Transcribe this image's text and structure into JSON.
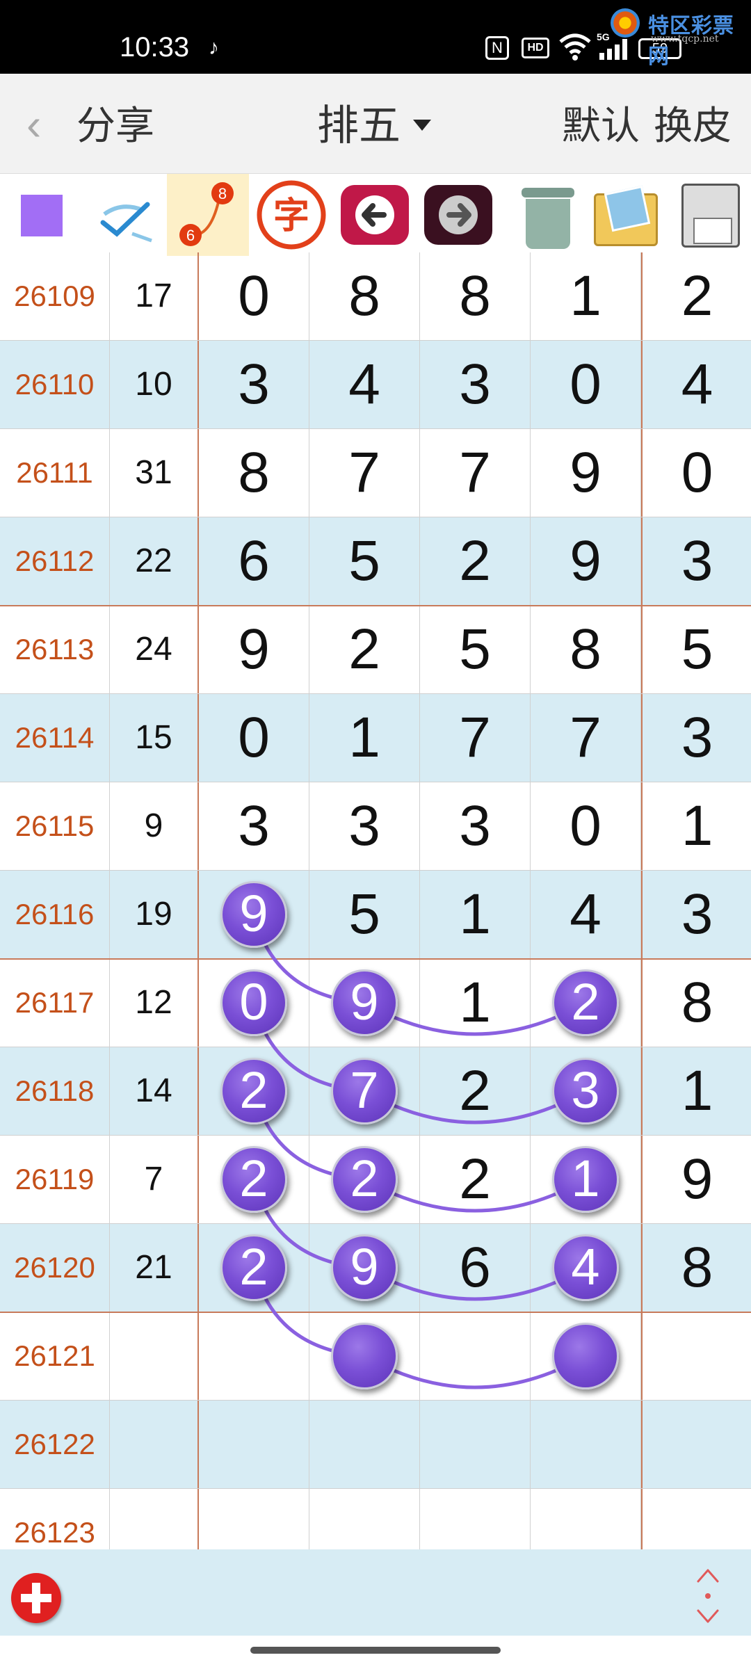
{
  "status_bar": {
    "time": "10:33",
    "hd_label": "HD",
    "battery": "59",
    "watermark_title": "特区彩票网",
    "watermark_url": "www.tqcp.net",
    "icons": [
      "tiktok-icon",
      "nfc-icon",
      "hd-icon",
      "wifi-icon",
      "5g-signal-icon",
      "battery-icon"
    ]
  },
  "header": {
    "back_icon": "chevron-left-icon",
    "share_label": "分享",
    "lottery_name": "排五",
    "default_label": "默认",
    "skin_label": "换皮"
  },
  "toolbar": {
    "tools": [
      "purple-color-swatch",
      "pen-check-tool-icon",
      "connect-line-tool-icon",
      "text-tool-icon",
      "undo-arrow-icon",
      "redo-arrow-icon",
      "trash-icon",
      "pictures-folder-icon",
      "save-floppy-icon"
    ],
    "connect_tool_labels": [
      "8",
      "6"
    ],
    "text_tool_label": "字",
    "accent_color": "#a26ef5"
  },
  "table": {
    "rows": [
      {
        "issue": "26109",
        "sum": "17",
        "digits": [
          "0",
          "8",
          "8",
          "1",
          "2"
        ]
      },
      {
        "issue": "26110",
        "sum": "10",
        "digits": [
          "3",
          "4",
          "3",
          "0",
          "4"
        ]
      },
      {
        "issue": "26111",
        "sum": "31",
        "digits": [
          "8",
          "7",
          "7",
          "9",
          "0"
        ]
      },
      {
        "issue": "26112",
        "sum": "22",
        "digits": [
          "6",
          "5",
          "2",
          "9",
          "3"
        ]
      },
      {
        "issue": "26113",
        "sum": "24",
        "digits": [
          "9",
          "2",
          "5",
          "8",
          "5"
        ]
      },
      {
        "issue": "26114",
        "sum": "15",
        "digits": [
          "0",
          "1",
          "7",
          "7",
          "3"
        ]
      },
      {
        "issue": "26115",
        "sum": "9",
        "digits": [
          "3",
          "3",
          "3",
          "0",
          "1"
        ]
      },
      {
        "issue": "26116",
        "sum": "19",
        "digits": [
          "9",
          "5",
          "1",
          "4",
          "3"
        ]
      },
      {
        "issue": "26117",
        "sum": "12",
        "digits": [
          "0",
          "9",
          "1",
          "2",
          "8"
        ]
      },
      {
        "issue": "26118",
        "sum": "14",
        "digits": [
          "2",
          "7",
          "2",
          "3",
          "1"
        ]
      },
      {
        "issue": "26119",
        "sum": "7",
        "digits": [
          "2",
          "2",
          "2",
          "1",
          "9"
        ]
      },
      {
        "issue": "26120",
        "sum": "21",
        "digits": [
          "2",
          "9",
          "6",
          "4",
          "8"
        ]
      },
      {
        "issue": "26121",
        "sum": "",
        "digits": [
          "",
          "",
          "",
          "",
          ""
        ]
      },
      {
        "issue": "26122",
        "sum": "",
        "digits": [
          "",
          "",
          "",
          "",
          ""
        ]
      },
      {
        "issue": "26123",
        "sum": "",
        "digits": [
          "",
          "",
          "",
          "",
          ""
        ]
      }
    ],
    "marked_balls": [
      {
        "issue": "26116",
        "column": 1,
        "label": "9"
      },
      {
        "issue": "26117",
        "column": 1,
        "label": "0"
      },
      {
        "issue": "26117",
        "column": 2,
        "label": "9"
      },
      {
        "issue": "26117",
        "column": 4,
        "label": "2"
      },
      {
        "issue": "26118",
        "column": 1,
        "label": "2"
      },
      {
        "issue": "26118",
        "column": 2,
        "label": "7"
      },
      {
        "issue": "26118",
        "column": 4,
        "label": "3"
      },
      {
        "issue": "26119",
        "column": 1,
        "label": "2"
      },
      {
        "issue": "26119",
        "column": 2,
        "label": "2"
      },
      {
        "issue": "26119",
        "column": 4,
        "label": "1"
      },
      {
        "issue": "26120",
        "column": 1,
        "label": "2"
      },
      {
        "issue": "26120",
        "column": 2,
        "label": "9"
      },
      {
        "issue": "26120",
        "column": 4,
        "label": "4"
      },
      {
        "issue": "26121",
        "column": 2,
        "label": ""
      },
      {
        "issue": "26121",
        "column": 4,
        "label": ""
      }
    ],
    "issue_color": "#c4501a",
    "alt_row_color": "#d7ecf4",
    "ball_color": "#7a4fd6"
  },
  "bottom_bar": {
    "add_icon": "add-plus-icon",
    "resize_icon": "resize-updown-icon"
  }
}
